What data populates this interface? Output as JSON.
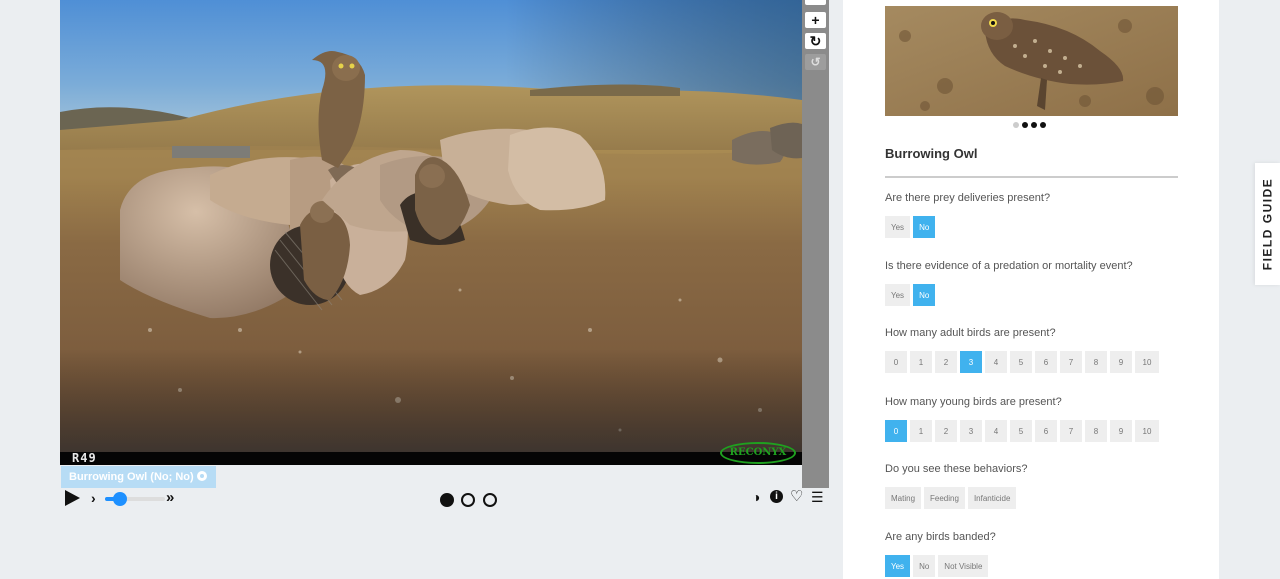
{
  "viewer": {
    "camera_id": "R49",
    "camera_brand": "RECONYX",
    "subject_label": "Burrowing Owl (No; No)",
    "tools": [
      "plus-icon",
      "rotate-icon",
      "reset-icon"
    ],
    "playback": {
      "speed_fraction": 0.25,
      "frames": 3,
      "current_frame": 1
    },
    "controls": [
      "contrast-icon",
      "info-icon",
      "heart-icon",
      "collection-list-icon"
    ]
  },
  "panel": {
    "example_images": 4,
    "example_current": 1,
    "species_name": "Burrowing Owl",
    "questions": [
      {
        "text": "Are there prey deliveries present?",
        "options": [
          "Yes",
          "No"
        ],
        "selected": [
          "No"
        ]
      },
      {
        "text": "Is there evidence of a predation or mortality event?",
        "options": [
          "Yes",
          "No"
        ],
        "selected": [
          "No"
        ]
      },
      {
        "text": "How many adult birds are present?",
        "options": [
          "0",
          "1",
          "2",
          "3",
          "4",
          "5",
          "6",
          "7",
          "8",
          "9",
          "10"
        ],
        "selected": [
          "3"
        ]
      },
      {
        "text": "How many young birds are present?",
        "options": [
          "0",
          "1",
          "2",
          "3",
          "4",
          "5",
          "6",
          "7",
          "8",
          "9",
          "10"
        ],
        "selected": [
          "0"
        ]
      },
      {
        "text": "Do you see these behaviors?",
        "options": [
          "Mating",
          "Feeding",
          "Infanticide"
        ],
        "selected": []
      },
      {
        "text": "Are any birds banded?",
        "options": [
          "Yes",
          "No",
          "Not Visible"
        ],
        "selected": [
          "Yes"
        ]
      }
    ]
  },
  "field_guide": {
    "label": "FIELD GUIDE"
  },
  "colors": {
    "accent": "#40b2ee",
    "subject_label_bg": "#b7dcf5",
    "camera_logo": "#1fa11f"
  }
}
